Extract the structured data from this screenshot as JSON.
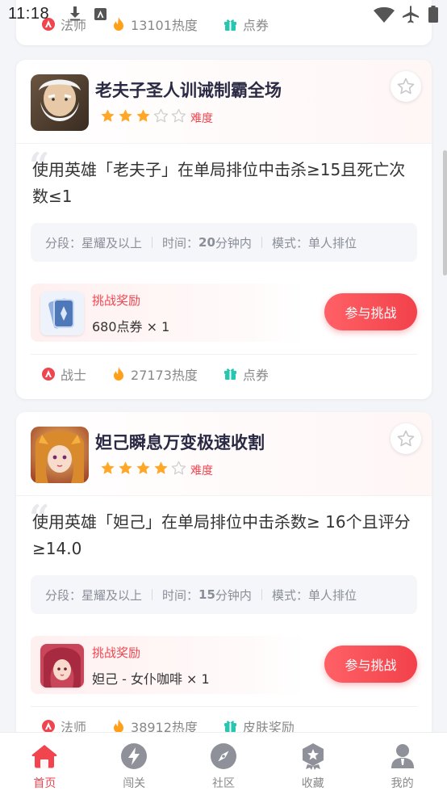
{
  "status_bar": {
    "time": "11:18"
  },
  "partial_card": {
    "tags": [
      {
        "icon": "class-icon",
        "text": "法师"
      },
      {
        "icon": "fire-icon",
        "text": "13101热度"
      },
      {
        "icon": "gift-icon",
        "text": "点券"
      }
    ]
  },
  "cards": [
    {
      "title": "老夫子圣人训诫制霸全场",
      "stars": 3,
      "max_stars": 5,
      "difficulty_label": "难度",
      "quote_mark": "“",
      "description": "使用英雄「老夫子」在单局排位中击杀≥15且死亡次数≤1",
      "meta": {
        "rank_label": "分段：",
        "rank_value": "星耀及以上",
        "time_label": "时间：",
        "time_num": "20",
        "time_unit": "分钟内",
        "mode_label": "模式：",
        "mode_value": "单人排位"
      },
      "reward": {
        "label": "挑战奖励",
        "value": "680点券 × 1",
        "icon": "coupon-card-icon"
      },
      "join_label": "参与挑战",
      "tags": [
        {
          "icon": "class-icon",
          "text": "战士"
        },
        {
          "icon": "fire-icon",
          "text": "27173热度"
        },
        {
          "icon": "gift-icon",
          "text": "点券"
        }
      ]
    },
    {
      "title": "妲己瞬息万变极速收割",
      "stars": 4,
      "max_stars": 5,
      "difficulty_label": "难度",
      "quote_mark": "“",
      "description": "使用英雄「妲己」在单局排位中击杀数≥ 16个且评分≥14.0",
      "meta": {
        "rank_label": "分段：",
        "rank_value": "星耀及以上",
        "time_label": "时间：",
        "time_num": "15",
        "time_unit": "分钟内",
        "mode_label": "模式：",
        "mode_value": "单人排位"
      },
      "reward": {
        "label": "挑战奖励",
        "value": "妲己 - 女仆咖啡 × 1",
        "icon": "skin-portrait-icon"
      },
      "join_label": "参与挑战",
      "tags": [
        {
          "icon": "class-icon",
          "text": "法师"
        },
        {
          "icon": "fire-icon",
          "text": "38912热度"
        },
        {
          "icon": "gift-icon",
          "text": "皮肤奖励"
        }
      ]
    }
  ],
  "tabbar": {
    "items": [
      {
        "label": "首页",
        "icon": "home-icon",
        "active": true
      },
      {
        "label": "闯关",
        "icon": "lightning-icon",
        "active": false
      },
      {
        "label": "社区",
        "icon": "compass-icon",
        "active": false
      },
      {
        "label": "收藏",
        "icon": "badge-icon",
        "active": false
      },
      {
        "label": "我的",
        "icon": "profile-icon",
        "active": false
      }
    ]
  },
  "colors": {
    "accent": "#f0454f",
    "star": "#ffa726",
    "gift": "#26c6b0",
    "fire": "#ff9f1a"
  }
}
